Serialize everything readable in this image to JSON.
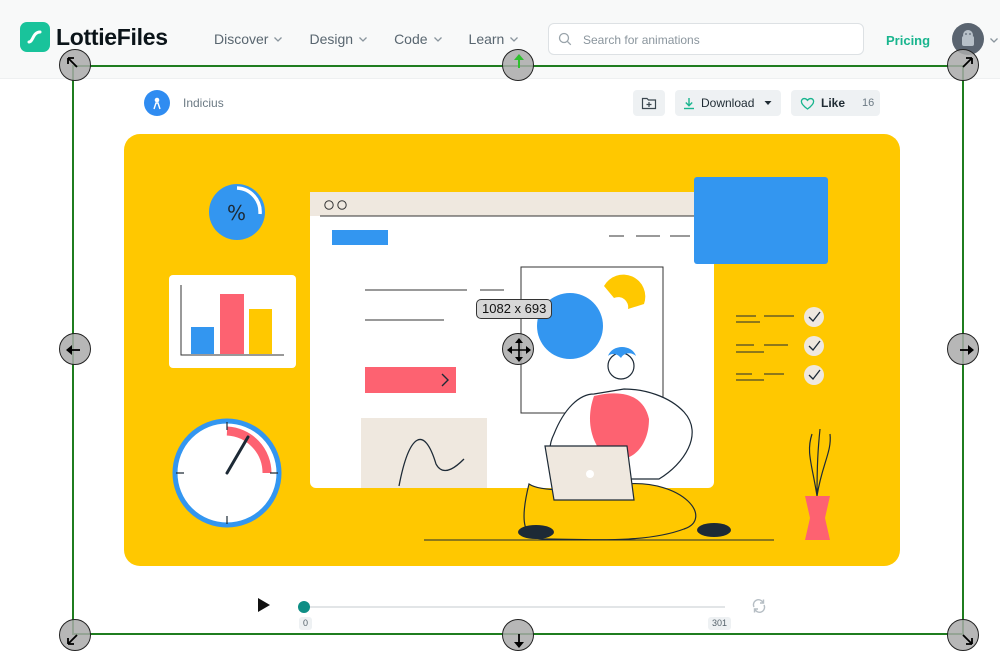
{
  "header": {
    "logo_text": "LottieFiles",
    "nav": [
      {
        "label": "Discover"
      },
      {
        "label": "Design"
      },
      {
        "label": "Code"
      },
      {
        "label": "Learn"
      }
    ],
    "search_placeholder": "Search for animations",
    "pricing_label": "Pricing"
  },
  "animation": {
    "author": "Indicius",
    "download_label": "Download",
    "like_label": "Like",
    "like_count": "16"
  },
  "player": {
    "frame_start": "0",
    "frame_end": "301",
    "current_frame": 0,
    "total_frames": 301
  },
  "selection": {
    "size_label": "1082 x 693"
  },
  "colors": {
    "brand": "#19c39b",
    "illustration_background": "#ffc800",
    "selection_border": "#1f7d1f",
    "progress_knob": "#0e8e85"
  }
}
